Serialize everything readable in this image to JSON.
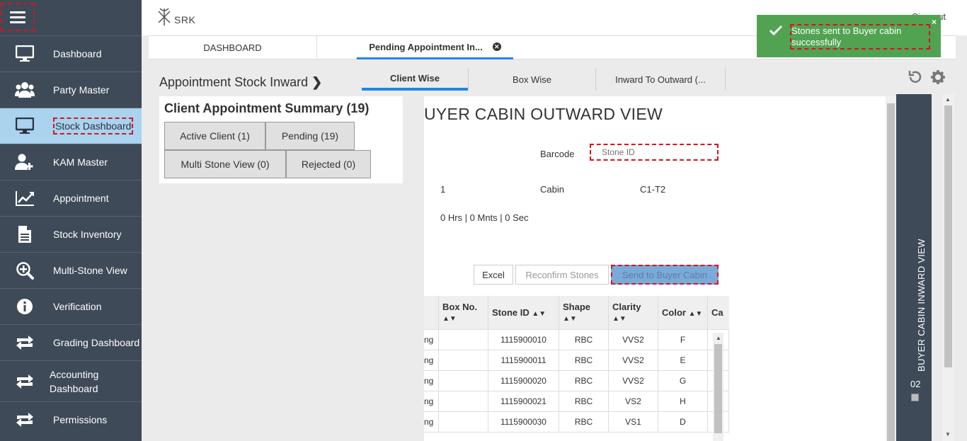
{
  "header": {
    "logo_text": "SRK",
    "hidden_action": "Sign out"
  },
  "sidebar": {
    "items": [
      {
        "label": "Dashboard",
        "icon": "monitor-icon"
      },
      {
        "label": "Party Master",
        "icon": "users-icon"
      },
      {
        "label": "Stock Dashboard",
        "icon": "monitor-icon",
        "active": true
      },
      {
        "label": "KAM Master",
        "icon": "user-plus-icon"
      },
      {
        "label": "Appointment",
        "icon": "line-chart-icon"
      },
      {
        "label": "Stock Inventory",
        "icon": "document-icon"
      },
      {
        "label": "Multi-Stone View",
        "icon": "zoom-in-icon"
      },
      {
        "label": "Verification",
        "icon": "info-icon"
      },
      {
        "label": "Grading Dashboard",
        "icon": "exchange-icon"
      },
      {
        "label": "Accounting Dashboard",
        "icon": "exchange-icon"
      },
      {
        "label": "Permissions",
        "icon": "exchange-icon"
      }
    ]
  },
  "tabs": {
    "dashboard": "DASHBOARD",
    "pending": "Pending Appointment In..."
  },
  "page": {
    "title": "Appointment Stock Inward",
    "subtabs": [
      "Client Wise",
      "Box Wise",
      "Inward To Outward (..."
    ]
  },
  "summary": {
    "title": "Client Appointment Summary (19)",
    "buttons": [
      "Active Client (1)",
      "Pending (19)",
      "Multi Stone View (0)",
      "Rejected (0)"
    ]
  },
  "outward": {
    "title": "UYER CABIN OUTWARD VIEW",
    "barcode_label": "Barcode",
    "barcode_placeholder": "Stone ID",
    "count_value": "1",
    "cabin_label": "Cabin",
    "cabin_value": "C1-T2",
    "timer": "0 Hrs | 0 Mnts | 0 Sec",
    "buttons": {
      "excel": "Excel",
      "reconfirm": "Reconfirm Stones",
      "send": "Send to Buyer Cabin"
    }
  },
  "table": {
    "columns": [
      "Box No.",
      "Stone ID",
      "Shape",
      "Clarity",
      "Color",
      "Ca"
    ],
    "first_col_fragment": "ng",
    "rows": [
      {
        "stone_id": "1115900010",
        "shape": "RBC",
        "clarity": "VVS2",
        "color": "F"
      },
      {
        "stone_id": "1115900011",
        "shape": "RBC",
        "clarity": "VVS2",
        "color": "E"
      },
      {
        "stone_id": "1115900020",
        "shape": "RBC",
        "clarity": "VVS2",
        "color": "G"
      },
      {
        "stone_id": "1115900021",
        "shape": "RBC",
        "clarity": "VS2",
        "color": "H"
      },
      {
        "stone_id": "1115900030",
        "shape": "RBC",
        "clarity": "VS1",
        "color": "D"
      }
    ]
  },
  "inward_panel": {
    "title": "BUYER CABIN INWARD VIEW",
    "number": "02"
  },
  "toast": {
    "message": "Stones sent to Buyer cabin successfully",
    "close": "×"
  },
  "colors": {
    "sidebar_bg": "#3e4a57",
    "active_item_bg": "#a9d3ee",
    "accent_blue": "#1e88e5",
    "toast_green": "#51a351",
    "annotation_red": "#d8141c"
  }
}
